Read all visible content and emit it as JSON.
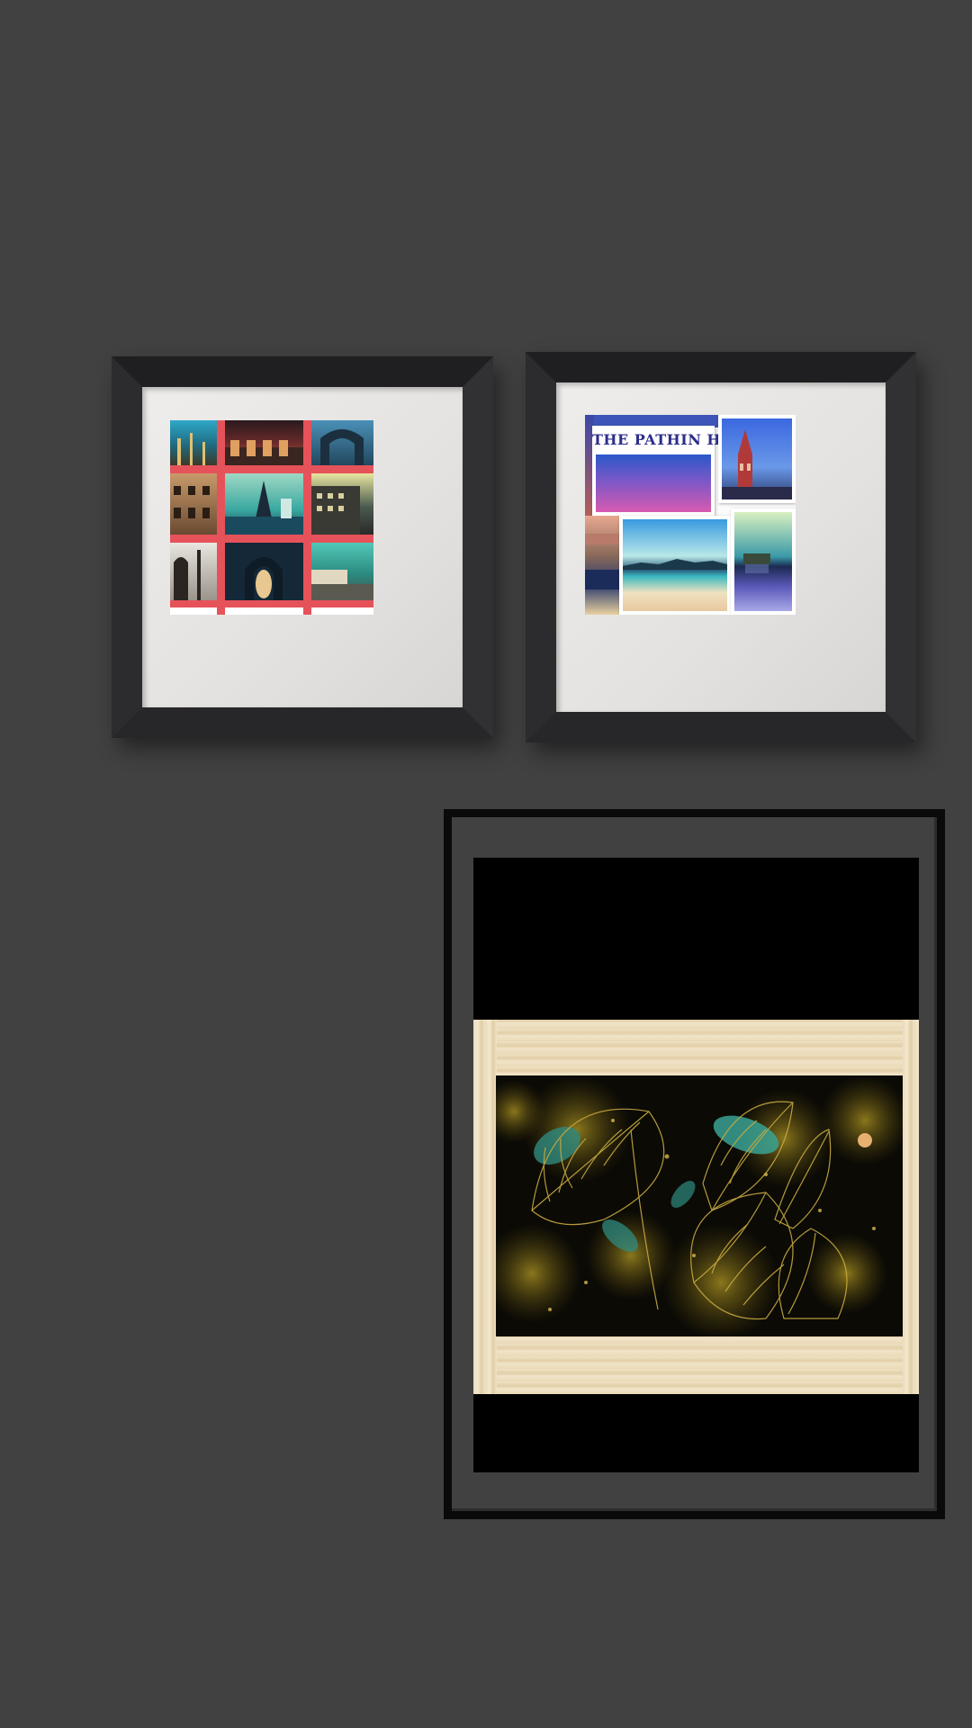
{
  "scene": {
    "type": "gallery-wall-mockup",
    "wall_color": "#414141",
    "frames": [
      {
        "id": "frame-left",
        "frame_color": "#2b2a2c",
        "mat_color": "#eae8e6",
        "artwork": "city-photo-collage-with-red-grid"
      },
      {
        "id": "frame-right",
        "frame_color": "#2b2a2c",
        "mat_color": "#eae8e6",
        "artwork": "travel-polaroid-collage",
        "handwritten_text": "THE PATHIN HIGHT"
      },
      {
        "id": "frame-portrait",
        "frame_color": "#0a0a0a",
        "inner_color": "#000000",
        "artwork": "golden-leaf-line-art-in-wooden-frame"
      }
    ]
  },
  "colors": {
    "grid_red": "#e6525a",
    "teal": "#2fb8a8",
    "navy": "#1b2a44",
    "gold": "#b89a2a",
    "wood": "#ecdcbc"
  }
}
